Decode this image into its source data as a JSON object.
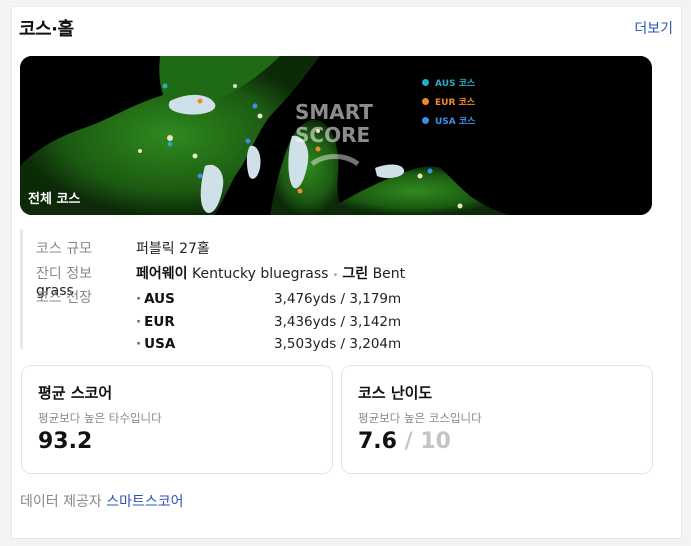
{
  "header": {
    "title": "코스·홀",
    "more_label": "더보기"
  },
  "map": {
    "caption": "전체 코스",
    "watermark_line1": "SMART",
    "watermark_line2": "SCORE",
    "legend": [
      {
        "label": "AUS 코스",
        "color": "#2aa8c7"
      },
      {
        "label": "EUR 코스",
        "color": "#f18a2a"
      },
      {
        "label": "USA 코스",
        "color": "#3d8ee6"
      }
    ]
  },
  "info": {
    "scale_label": "코스 규모",
    "scale_value": "퍼블릭 27홀",
    "grass_label": "잔디 정보",
    "fairway_label": "페어웨이",
    "fairway_value": "Kentucky bluegrass",
    "green_label": "그린",
    "green_value": "Bent grass",
    "length_label": "코스 전장",
    "lengths": [
      {
        "name": "AUS",
        "value": "3,476yds / 3,179m"
      },
      {
        "name": "EUR",
        "value": "3,436yds / 3,142m"
      },
      {
        "name": "USA",
        "value": "3,503yds / 3,204m"
      }
    ]
  },
  "stats": {
    "avg": {
      "title": "평균 스코어",
      "sub": "평균보다 높은 타수입니다",
      "value": "93.2"
    },
    "difficulty": {
      "title": "코스 난이도",
      "sub": "평균보다 높은 코스입니다",
      "value": "7.6",
      "max": "/ 10"
    }
  },
  "footer": {
    "label": "데이터 제공자",
    "provider": "스마트스코어"
  }
}
